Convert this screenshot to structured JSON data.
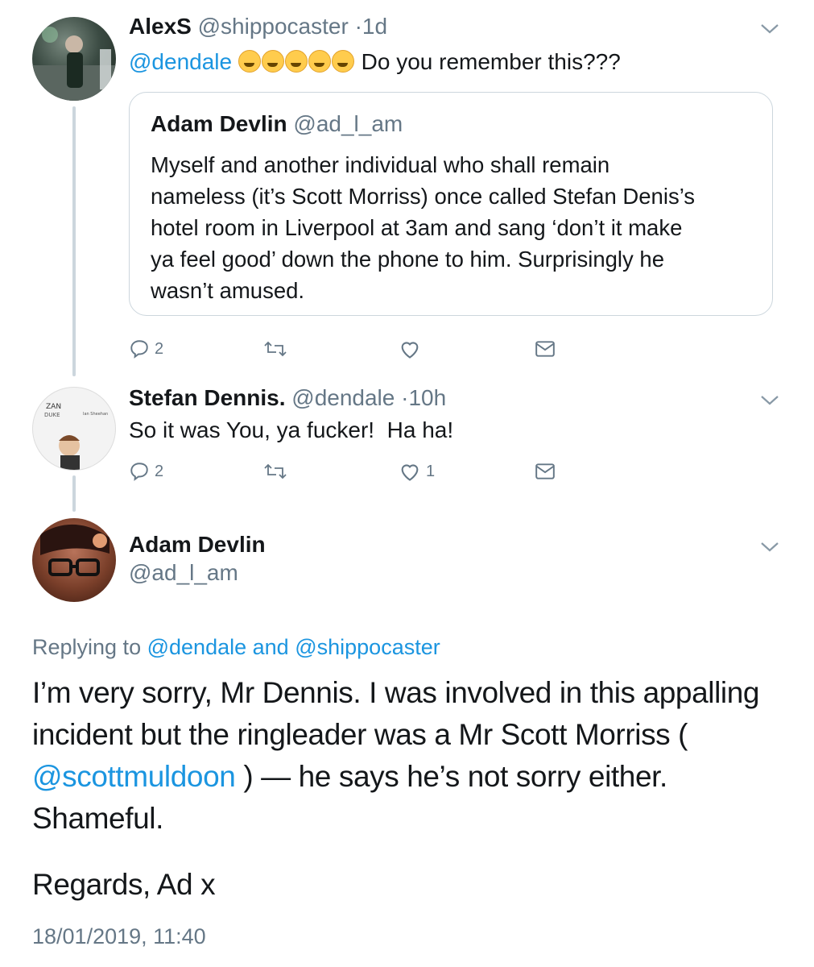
{
  "tweet1": {
    "display_name": "AlexS",
    "handle": "@shippocaster",
    "sep": "·",
    "time": "1d",
    "mention": "@dendale",
    "emoji": [
      "rofl-emoji",
      "rofl-emoji",
      "rofl-emoji",
      "rofl-emoji",
      "rofl-emoji"
    ],
    "text": "Do you remember this???",
    "quote": {
      "display_name": "Adam Devlin",
      "handle": "@ad_l_am",
      "text": "Myself and another individual who shall remain\nnameless (it’s Scott Morriss) once called Stefan Denis’s\nhotel room in Liverpool at 3am and sang ‘don’t it make\nya feel good’ down the phone to him. Surprisingly he\nwasn’t amused."
    },
    "actions": {
      "replies": "2",
      "retweets": "",
      "likes": ""
    }
  },
  "tweet2": {
    "display_name": "Stefan Dennis.",
    "handle": "@dendale",
    "sep": "·",
    "time": "10h",
    "text": "So it was You, ya fucker!  Ha ha!",
    "actions": {
      "replies": "2",
      "retweets": "",
      "likes": "1"
    }
  },
  "tweet3": {
    "display_name": "Adam Devlin",
    "handle": "@ad_l_am",
    "replying_prefix": "Replying to",
    "replying_user1": "@dendale",
    "replying_and": "and",
    "replying_user2": "@shippocaster",
    "text_part1": "I’m very sorry, Mr Dennis. I was involved in this appalling incident but the ringleader was a Mr Scott Morriss (",
    "mention": "@scottmuldoon",
    "text_part2": ") — he says he’s not sorry either. Shameful.",
    "signoff": "Regards, Ad x",
    "timestamp": "18/01/2019, 11:40"
  },
  "icons": {
    "reply": "reply-icon",
    "retweet": "retweet-icon",
    "like": "heart-icon",
    "dm": "envelope-icon",
    "menu": "chevron-down-icon"
  },
  "colors": {
    "link": "#1b95e0",
    "muted": "#657786",
    "text": "#14171a",
    "border": "#ccd6dd"
  }
}
